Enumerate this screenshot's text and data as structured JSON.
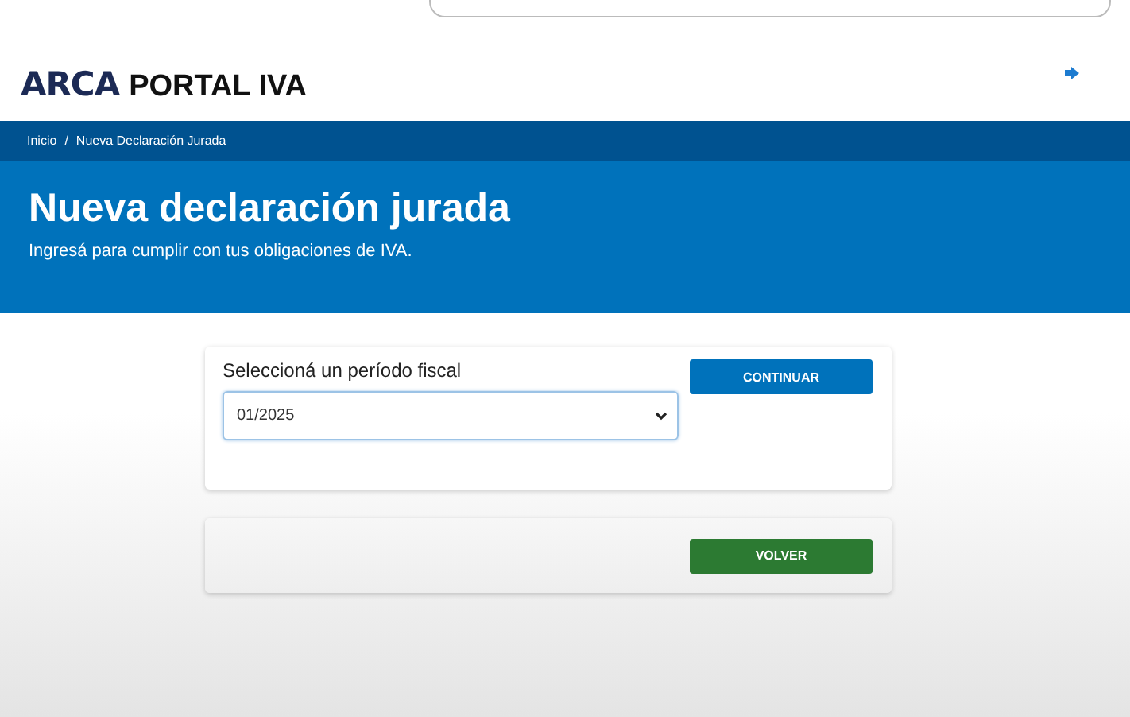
{
  "header": {
    "logo": "ARCA",
    "product": "PORTAL IVA"
  },
  "breadcrumb": [
    "Inicio",
    "Nueva Declaración Jurada"
  ],
  "breadcrumb_separator": "/",
  "hero": {
    "title": "Nueva declaración jurada",
    "subtitle": "Ingresá para cumplir con tus obligaciones de IVA."
  },
  "period_form": {
    "label": "Seleccioná un período fiscal",
    "value": "01/2025",
    "button": "CONTINUAR"
  },
  "back_button": "VOLVER"
}
